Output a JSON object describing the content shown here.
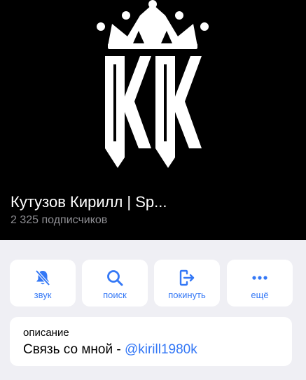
{
  "theme": {
    "accent": "#3478f6",
    "header_bg": "#000000",
    "page_bg": "#efeff4"
  },
  "header": {
    "logo_icon": "kk-crown-logo",
    "title": "Кутузов Кирилл | Sp...",
    "subscribers": "2 325 подписчиков"
  },
  "actions": [
    {
      "icon": "bell-muted-icon",
      "label": "звук"
    },
    {
      "icon": "search-icon",
      "label": "поиск"
    },
    {
      "icon": "leave-icon",
      "label": "покинуть"
    },
    {
      "icon": "more-dots-icon",
      "label": "ещё"
    }
  ],
  "description": {
    "label": "описание",
    "text": "Связь со мной - ",
    "link": "@kirill1980k"
  }
}
